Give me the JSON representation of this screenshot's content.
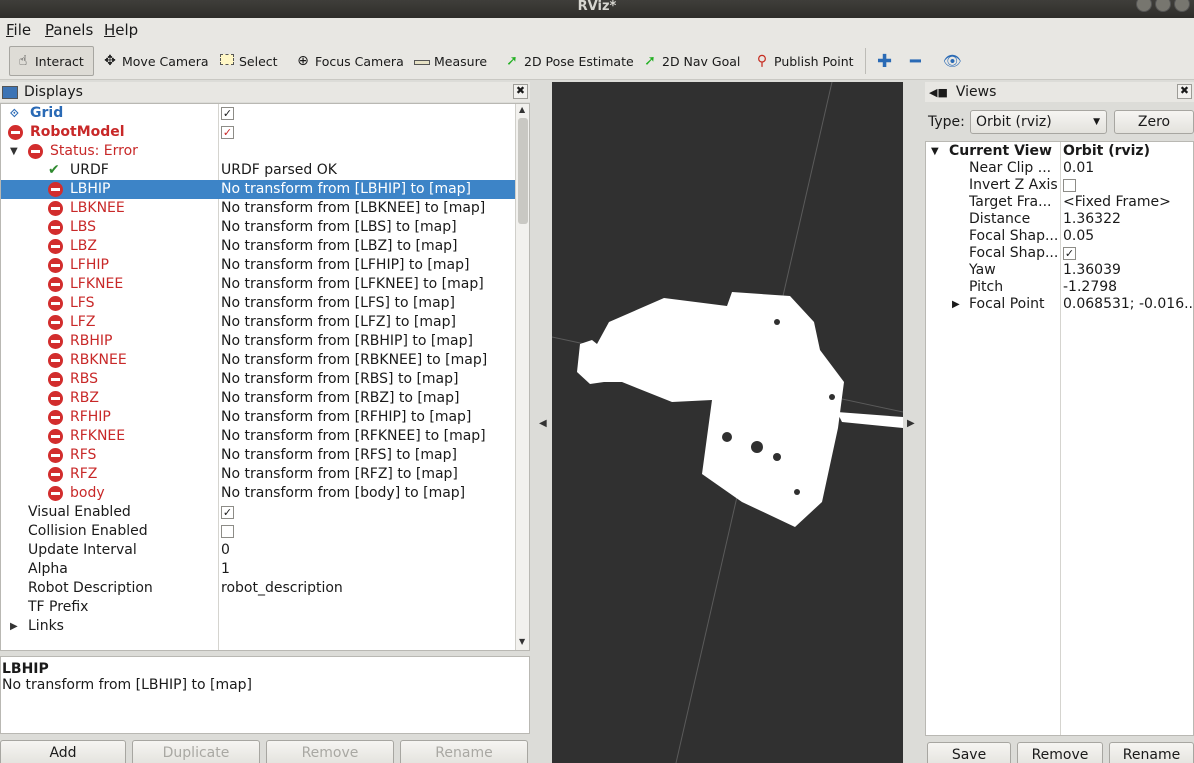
{
  "window": {
    "title": "RViz*"
  },
  "menu": [
    {
      "key": "F",
      "rest": "ile"
    },
    {
      "key": "P",
      "rest": "anels"
    },
    {
      "key": "H",
      "rest": "elp"
    }
  ],
  "toolbar": {
    "tools": [
      {
        "label": "Interact",
        "icon": "hand-pointer-icon"
      },
      {
        "label": "Move Camera",
        "icon": "move-camera-icon"
      },
      {
        "label": "Select",
        "icon": "select-box-icon"
      },
      {
        "label": "Focus Camera",
        "icon": "focus-camera-icon"
      },
      {
        "label": "Measure",
        "icon": "ruler-icon"
      },
      {
        "label": "2D Pose Estimate",
        "icon": "green-arrow-icon"
      },
      {
        "label": "2D Nav Goal",
        "icon": "green-arrow-icon"
      },
      {
        "label": "Publish Point",
        "icon": "map-pin-icon"
      }
    ]
  },
  "displays": {
    "header": "Displays",
    "rows": [
      {
        "name": "Grid",
        "value": ""
      },
      {
        "name": "RobotModel",
        "value": ""
      },
      {
        "name": "Status: Error",
        "value": ""
      },
      {
        "name": "URDF",
        "value": "URDF parsed OK"
      },
      {
        "name": "LBHIP",
        "value": "No transform from [LBHIP] to [map]"
      },
      {
        "name": "LBKNEE",
        "value": "No transform from [LBKNEE] to [map]"
      },
      {
        "name": "LBS",
        "value": "No transform from [LBS] to [map]"
      },
      {
        "name": "LBZ",
        "value": "No transform from [LBZ] to [map]"
      },
      {
        "name": "LFHIP",
        "value": "No transform from [LFHIP] to [map]"
      },
      {
        "name": "LFKNEE",
        "value": "No transform from [LFKNEE] to [map]"
      },
      {
        "name": "LFS",
        "value": "No transform from [LFS] to [map]"
      },
      {
        "name": "LFZ",
        "value": "No transform from [LFZ] to [map]"
      },
      {
        "name": "RBHIP",
        "value": "No transform from [RBHIP] to [map]"
      },
      {
        "name": "RBKNEE",
        "value": "No transform from [RBKNEE] to [map]"
      },
      {
        "name": "RBS",
        "value": "No transform from [RBS] to [map]"
      },
      {
        "name": "RBZ",
        "value": "No transform from [RBZ] to [map]"
      },
      {
        "name": "RFHIP",
        "value": "No transform from [RFHIP] to [map]"
      },
      {
        "name": "RFKNEE",
        "value": "No transform from [RFKNEE] to [map]"
      },
      {
        "name": "RFS",
        "value": "No transform from [RFS] to [map]"
      },
      {
        "name": "RFZ",
        "value": "No transform from [RFZ] to [map]"
      },
      {
        "name": "body",
        "value": "No transform from [body] to [map]"
      },
      {
        "name": "Visual Enabled",
        "value": ""
      },
      {
        "name": "Collision Enabled",
        "value": ""
      },
      {
        "name": "Update Interval",
        "value": "0"
      },
      {
        "name": "Alpha",
        "value": "1"
      },
      {
        "name": "Robot Description",
        "value": "robot_description"
      },
      {
        "name": "TF Prefix",
        "value": ""
      },
      {
        "name": "Links",
        "value": ""
      }
    ],
    "checks": {
      "grid": "✓",
      "robotmodel": "✓",
      "visual": "✓",
      "collision": ""
    }
  },
  "description": {
    "title": "LBHIP",
    "text": "No transform from [LBHIP] to [map]"
  },
  "display_buttons": {
    "add": "Add",
    "duplicate": "Duplicate",
    "remove": "Remove",
    "rename": "Rename"
  },
  "views": {
    "header": "Views",
    "type_label": "Type:",
    "type_value": "Orbit (rviz)",
    "zero": "Zero",
    "current_view": {
      "name": "Current View",
      "value": "Orbit (rviz)"
    },
    "props": [
      {
        "name": "Near Clip ...",
        "value": "0.01"
      },
      {
        "name": "Invert Z Axis",
        "value": ""
      },
      {
        "name": "Target Fra...",
        "value": "<Fixed Frame>"
      },
      {
        "name": "Distance",
        "value": "1.36322"
      },
      {
        "name": "Focal Shap...",
        "value": "0.05"
      },
      {
        "name": "Focal Shap...",
        "value": "✓"
      },
      {
        "name": "Yaw",
        "value": "1.36039"
      },
      {
        "name": "Pitch",
        "value": "-1.2798"
      },
      {
        "name": "Focal Point",
        "value": "0.068531; -0.016..."
      }
    ],
    "buttons": {
      "save": "Save",
      "remove": "Remove",
      "rename": "Rename"
    }
  },
  "colors": {
    "error_red": "#c82828",
    "selection_blue": "#3d84c7",
    "viewport_bg": "#303030"
  }
}
